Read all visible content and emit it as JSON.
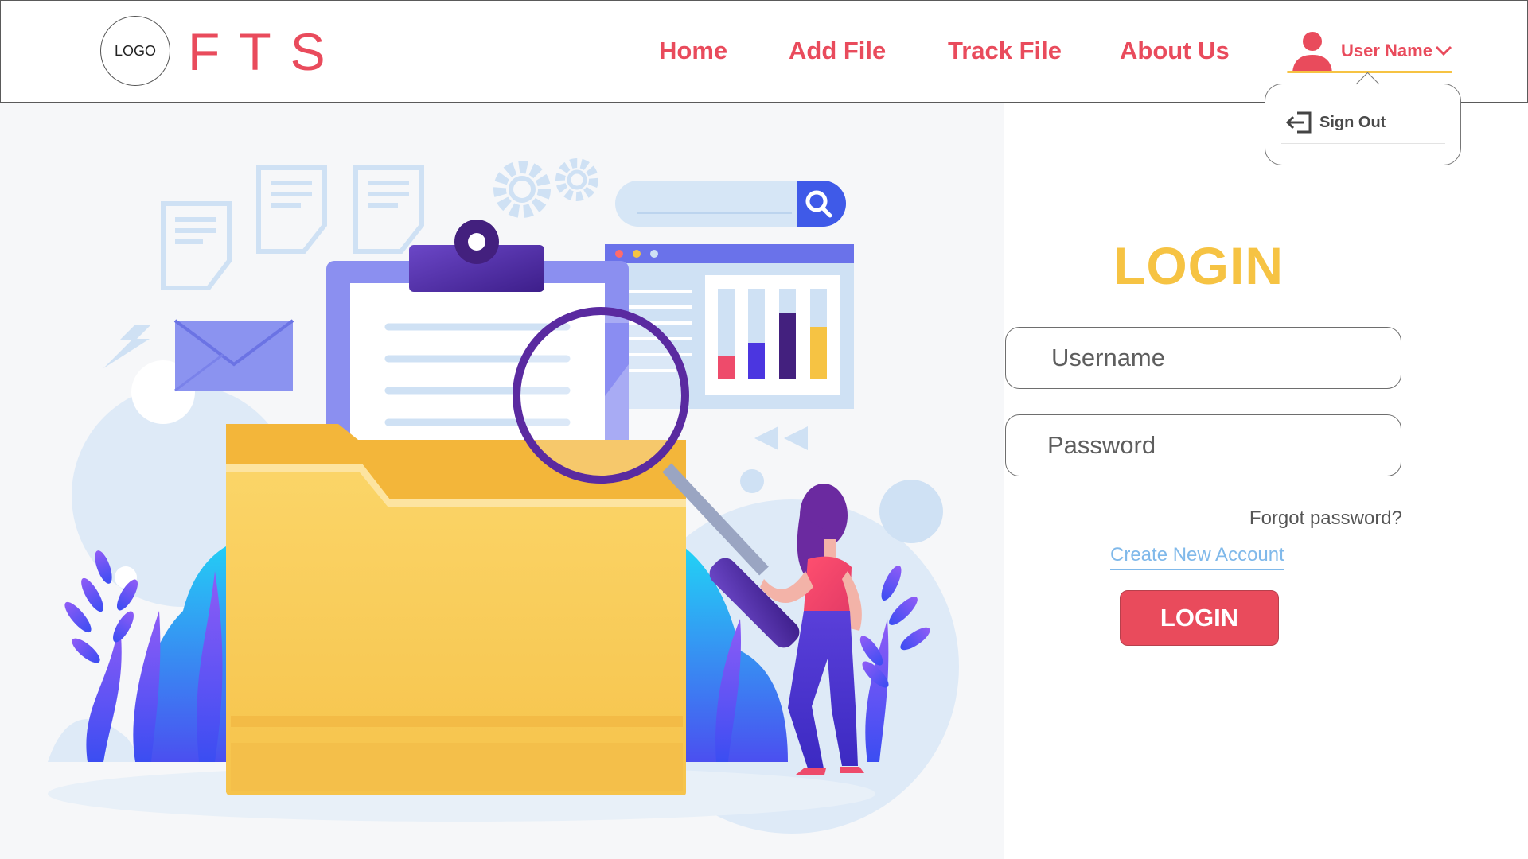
{
  "header": {
    "logo_text": "LOGO",
    "brand": "FTS",
    "nav": [
      {
        "label": "Home"
      },
      {
        "label": "Add File"
      },
      {
        "label": "Track File"
      },
      {
        "label": "About Us"
      }
    ],
    "user": {
      "name": "User Name",
      "icon": "user-icon",
      "chevron_icon": "chevron-down-icon"
    }
  },
  "dropdown": {
    "items": [
      {
        "label": "Sign Out",
        "icon": "sign-out-icon"
      }
    ]
  },
  "login": {
    "title": "LOGIN",
    "username_placeholder": "Username",
    "password_placeholder": "Password",
    "forgot_label": "Forgot password?",
    "create_label": "Create New Account",
    "button_label": "LOGIN"
  },
  "colors": {
    "brand": "#e94b5c",
    "accent_yellow": "#f6c343",
    "link_blue": "#80b9ea",
    "illustration_bg": "#f6f7f9"
  }
}
